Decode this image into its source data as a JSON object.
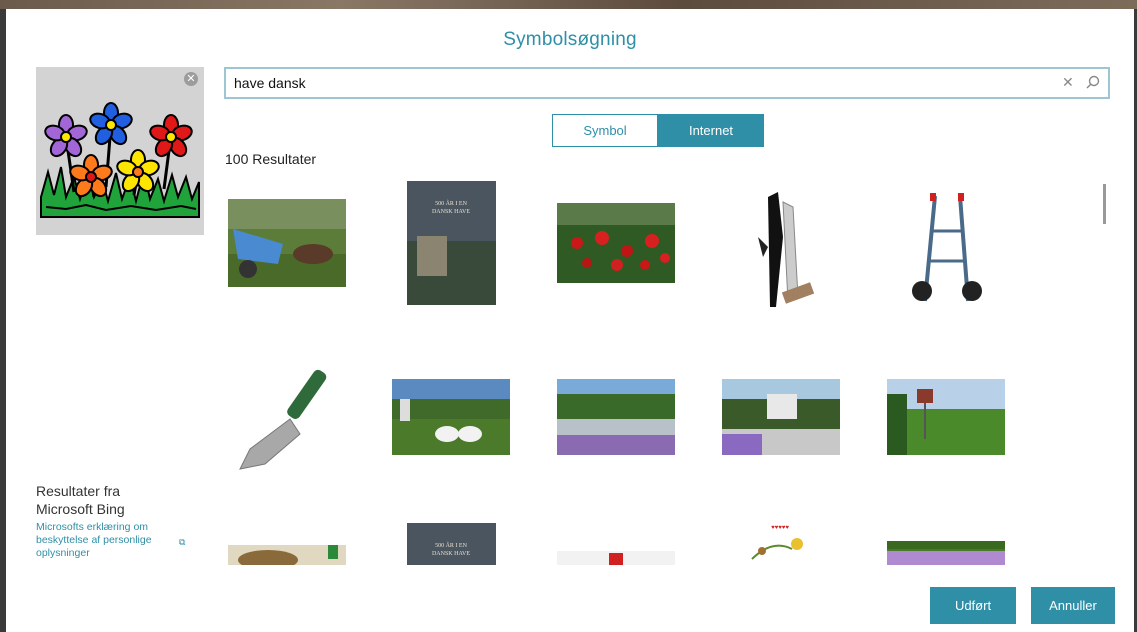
{
  "dialog": {
    "title": "Symbolsøgning"
  },
  "search": {
    "value": "have dansk",
    "clear_icon": "close-icon",
    "search_icon": "search-icon"
  },
  "toggle": {
    "symbol_label": "Symbol",
    "internet_label": "Internet",
    "active": "Internet"
  },
  "results": {
    "count_label": "100 Resultater",
    "thumbnails": [
      "wheelbarrow-garden-image",
      "book-cover-image",
      "red-roses-image",
      "pruning-shears-image",
      "hand-truck-image",
      "garden-trowel-image",
      "swan-sculptures-image",
      "park-fountain-image",
      "garden-gazebo-image",
      "garden-birdhouse-image",
      "food-plate-image",
      "book-cover-image-2",
      "logo-card-image",
      "floral-illustration-image",
      "flowerbed-image"
    ]
  },
  "bing": {
    "results_from": "Resultater fra",
    "provider": "Microsoft Bing",
    "privacy_link": "Microsofts erklæring om beskyttelse af personlige oplysninger"
  },
  "buttons": {
    "done": "Udført",
    "cancel": "Annuller"
  },
  "colors": {
    "accent": "#2f8fa7",
    "search_border": "#9dc5d2",
    "preview_bg": "#d3d3d3"
  }
}
